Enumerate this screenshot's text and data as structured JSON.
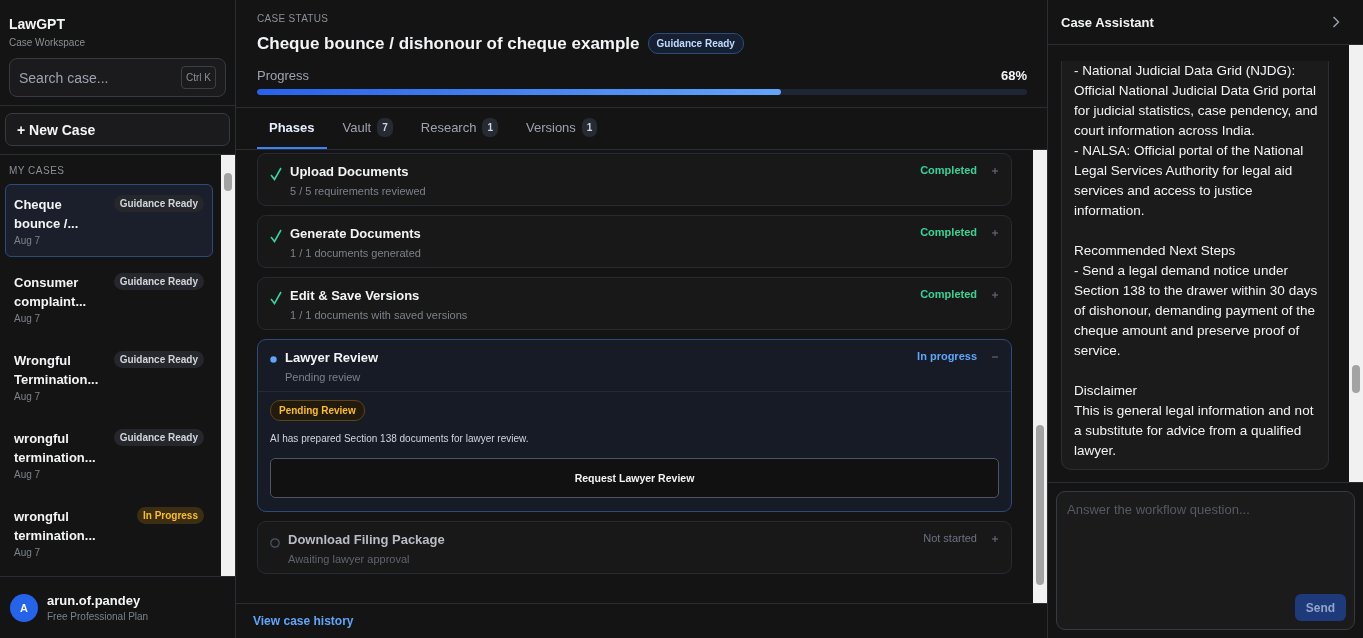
{
  "sidebar": {
    "brand": "LawGPT",
    "subtitle": "Case Workspace",
    "search": {
      "placeholder": "Search case...",
      "shortcut": "Ctrl K"
    },
    "new_case": "+ New Case",
    "section": "MY CASES",
    "cases": [
      {
        "title": "Cheque bounce /...",
        "date": "Aug 7",
        "badge": "Guidance Ready",
        "kind": "ready",
        "selected": true
      },
      {
        "title": "Consumer complaint...",
        "date": "Aug 7",
        "badge": "Guidance Ready",
        "kind": "ready",
        "selected": false
      },
      {
        "title": "Wrongful Termination...",
        "date": "Aug 7",
        "badge": "Guidance Ready",
        "kind": "ready",
        "selected": false
      },
      {
        "title": "wrongful termination...",
        "date": "Aug 7",
        "badge": "Guidance Ready",
        "kind": "ready",
        "selected": false
      },
      {
        "title": "wrongful termination...",
        "date": "Aug 7",
        "badge": "In Progress",
        "kind": "progress",
        "selected": false
      }
    ],
    "user": {
      "avatar": "A",
      "name": "arun.of.pandey",
      "plan": "Free Professional Plan"
    }
  },
  "header": {
    "eyebrow": "CASE STATUS",
    "title": "Cheque bounce / dishonour of cheque example",
    "badge": "Guidance Ready",
    "progress_label": "Progress",
    "progress_value": "68%",
    "level": 0.68
  },
  "tabs": [
    {
      "label": "Phases",
      "selected": true
    },
    {
      "label": "Vault",
      "count": "7",
      "selected": false
    },
    {
      "label": "Research",
      "count": "1",
      "selected": false
    },
    {
      "label": "Versions",
      "count": "1",
      "selected": false
    }
  ],
  "phases": [
    {
      "title": "Upload Documents",
      "detail": "5 / 5 requirements reviewed",
      "status": "Completed",
      "kind": "completed",
      "expanded": false
    },
    {
      "title": "Generate Documents",
      "detail": "1 / 1 documents generated",
      "status": "Completed",
      "kind": "completed",
      "expanded": false
    },
    {
      "title": "Edit & Save Versions",
      "detail": "1 / 1 documents with saved versions",
      "status": "Completed",
      "kind": "completed",
      "expanded": false
    },
    {
      "title": "Lawyer Review",
      "detail": "Pending review",
      "status": "In progress",
      "kind": "active",
      "expanded": true,
      "body": {
        "badge": "Pending Review",
        "text": "AI has prepared Section 138 documents for lawyer review.",
        "button": "Request Lawyer Review"
      }
    },
    {
      "title": "Download Filing Package",
      "detail": "Awaiting lawyer approval",
      "status": "Not started",
      "kind": "pending",
      "expanded": false
    }
  ],
  "footer_link": "View case history",
  "assistant": {
    "title": "Case Assistant",
    "message": [
      [
        "- National Judicial Data Grid (NJDG): Official National Judicial Data Grid portal for judicial statistics, case pendency, and court information across India.",
        "- NALSA: Official portal of the National Legal Services Authority for legal aid services and access to justice information."
      ],
      [
        "Recommended Next Steps",
        "- Send a legal demand notice under Section 138 to the drawer within 30 days of dishonour, demanding payment of the cheque amount and preserve proof of service."
      ],
      [
        "Disclaimer",
        "This is general legal information and not a substitute for advice from a qualified lawyer."
      ]
    ],
    "input": {
      "placeholder": "Answer the workflow question..."
    },
    "send": "Send"
  }
}
